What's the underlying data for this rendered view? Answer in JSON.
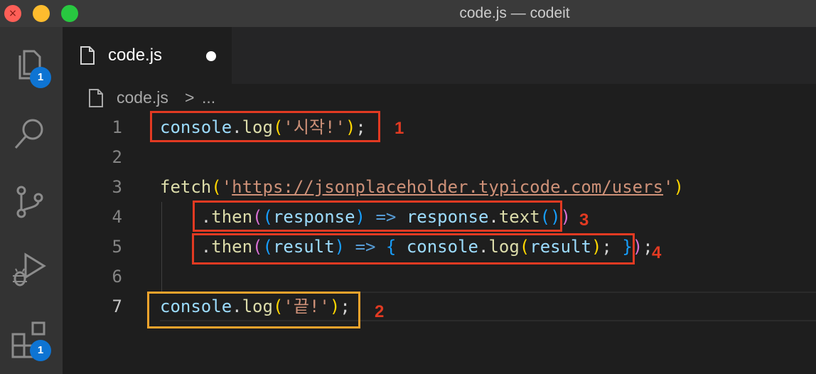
{
  "window": {
    "title": "code.js — codeit",
    "close_glyph": "×"
  },
  "activity_bar": {
    "items": [
      {
        "icon": "files-icon",
        "badge": "1"
      },
      {
        "icon": "search-icon"
      },
      {
        "icon": "source-control-icon"
      },
      {
        "icon": "run-debug-icon"
      },
      {
        "icon": "extensions-icon",
        "badge": "1"
      }
    ]
  },
  "tab": {
    "label": "code.js",
    "dirty": true
  },
  "breadcrumb": {
    "file": "code.js",
    "separator": ">",
    "more": "..."
  },
  "editor": {
    "active_line": 7,
    "lines": [
      {
        "number": "1",
        "text": "console.log('시작!');"
      },
      {
        "number": "2",
        "text": ""
      },
      {
        "number": "3",
        "text": "fetch('https://jsonplaceholder.typicode.com/users')"
      },
      {
        "number": "4",
        "text": "    .then((response) => response.text())"
      },
      {
        "number": "5",
        "text": "    .then((result) => { console.log(result); });"
      },
      {
        "number": "6",
        "text": ""
      },
      {
        "number": "7",
        "text": "console.log('끝!');"
      }
    ],
    "tokens": {
      "console": "console",
      "log": "log",
      "fetch": "fetch",
      "then": "then",
      "text": "text",
      "response": "response",
      "result": "result",
      "arrow": "=>",
      "str_start": "'시작!'",
      "str_end": "'끝!'",
      "url": "https://jsonplaceholder.typicode.com/users"
    }
  },
  "annotations": [
    {
      "label": "1",
      "color": "#e23a22"
    },
    {
      "label": "2",
      "color": "#f0a32c"
    },
    {
      "label": "3",
      "color": "#e23a22"
    },
    {
      "label": "4",
      "color": "#e23a22"
    }
  ]
}
